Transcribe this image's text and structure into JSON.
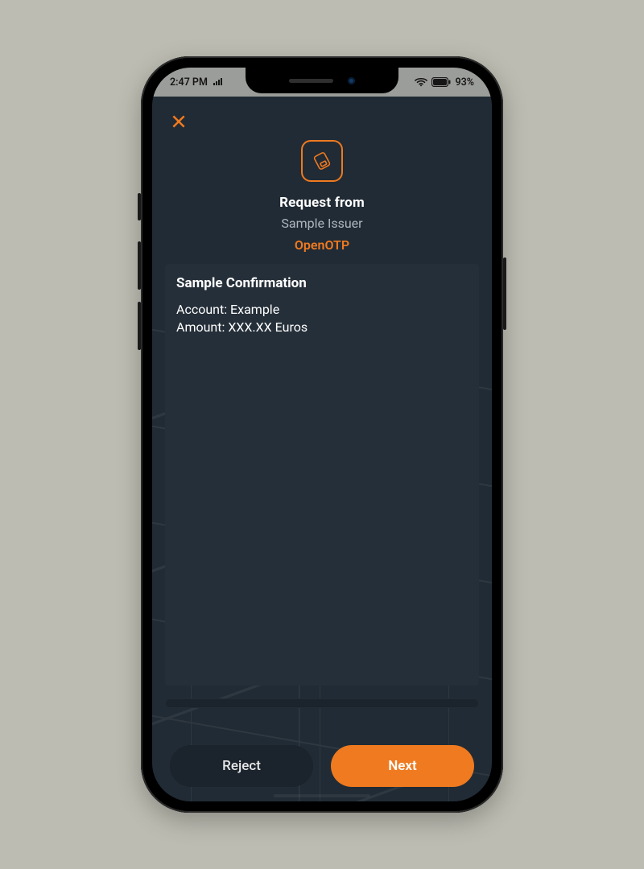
{
  "status_bar": {
    "time": "2:47 PM",
    "signal_icon": "signal-icon",
    "wifi_icon": "wifi-icon",
    "battery_icon": "battery-icon",
    "battery_text": "93%"
  },
  "close_icon": "close-icon",
  "header": {
    "request_icon": "request-card-icon",
    "title": "Request from",
    "issuer": "Sample Issuer",
    "product": "OpenOTP"
  },
  "card": {
    "title": "Sample Confirmation",
    "line1": "Account: Example",
    "line2": "Amount: XXX.XX Euros"
  },
  "actions": {
    "reject": "Reject",
    "next": "Next"
  },
  "colors": {
    "accent": "#f07a1f",
    "screen_bg": "#212b35",
    "card_bg": "#252f39"
  }
}
